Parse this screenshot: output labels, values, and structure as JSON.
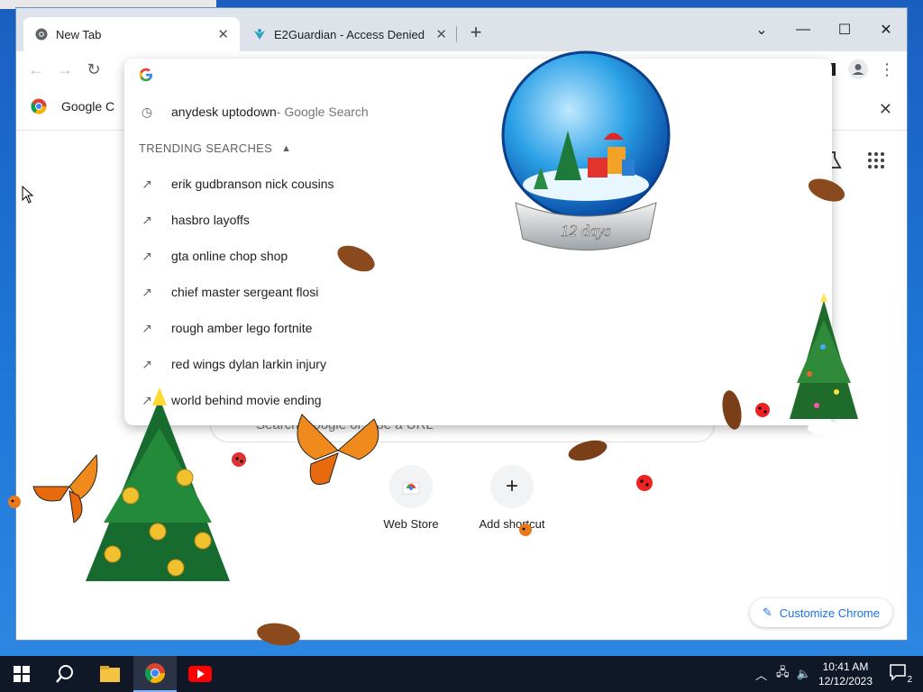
{
  "browser": {
    "tabs": [
      {
        "title": "New Tab",
        "active": true
      },
      {
        "title": "E2Guardian - Access Denied",
        "active": false
      }
    ]
  },
  "bookmark_bar": {
    "item_label": "Google C"
  },
  "omnibox": {
    "history_query": "anydesk uptodown",
    "history_suffix": " - Google Search",
    "trending_header": "TRENDING SEARCHES",
    "trending": [
      "erik gudbranson nick cousins",
      "hasbro layoffs",
      "gta online chop shop",
      "chief master sergeant flosi",
      "rough amber lego fortnite",
      "red wings dylan larkin injury",
      "world behind movie ending"
    ]
  },
  "ntp": {
    "search_placeholder": "Search Google or type a URL",
    "shortcuts": [
      {
        "label": "Web Store"
      },
      {
        "label": "Add shortcut"
      }
    ],
    "customize_label": "Customize Chrome"
  },
  "globe_label": "12 days",
  "taskbar": {
    "time": "10:41 AM",
    "date": "12/12/2023",
    "notifications_count": "2"
  },
  "colors": {
    "accent": "#1a73e8",
    "tabstrip": "#dee3ea",
    "taskbar": "#101828"
  }
}
